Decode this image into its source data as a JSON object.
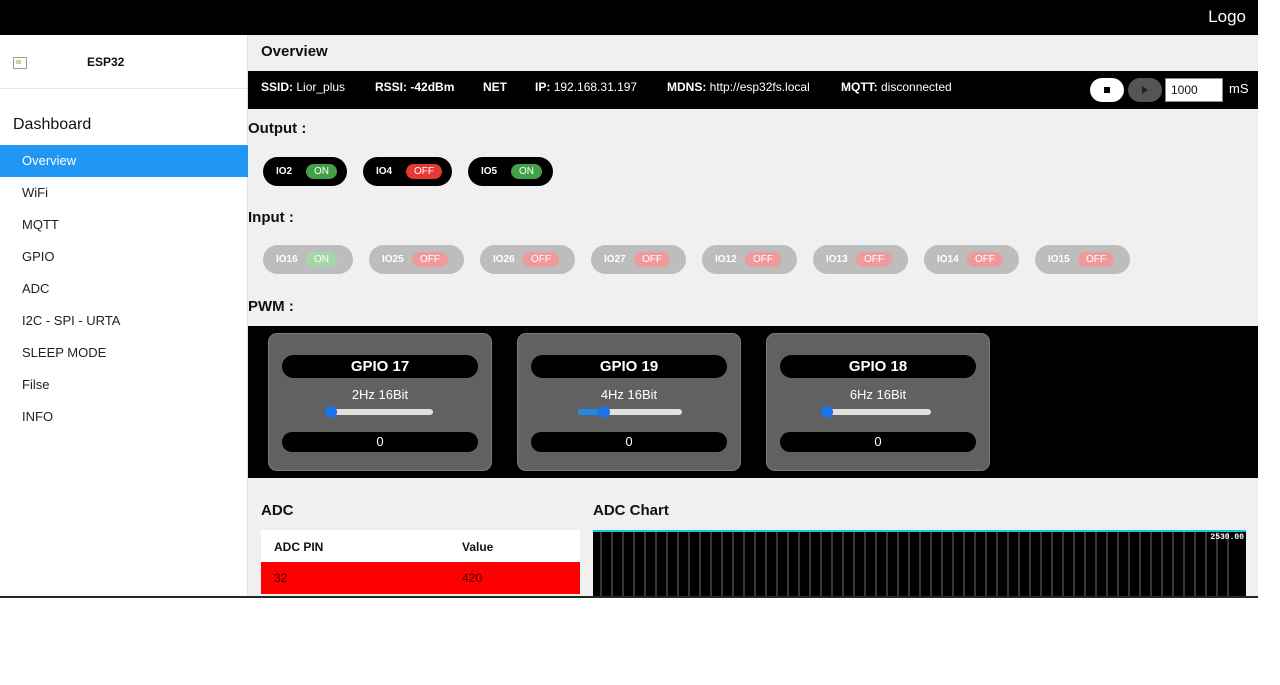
{
  "topbar": {
    "logo": "Logo"
  },
  "sidebar": {
    "brand": "ESP32",
    "section": "Dashboard",
    "items": [
      {
        "label": "Overview",
        "active": true
      },
      {
        "label": "WiFi"
      },
      {
        "label": "MQTT"
      },
      {
        "label": "GPIO"
      },
      {
        "label": "ADC"
      },
      {
        "label": "I2C - SPI - URTA"
      },
      {
        "label": "SLEEP MODE"
      },
      {
        "label": "Filse"
      },
      {
        "label": "INFO"
      }
    ]
  },
  "main": {
    "title": "Overview",
    "status": {
      "ssid_key": "SSID:",
      "ssid": "Lior_plus",
      "rssi_key": "RSSI:",
      "rssi": "-42dBm",
      "net_key": "NET",
      "ip_key": "IP:",
      "ip": "192.168.31.197",
      "mdns_key": "MDNS:",
      "mdns": "http://esp32fs.local",
      "mqtt_key": "MQTT:",
      "mqtt": "disconnected",
      "interval": "1000",
      "interval_unit": "mS"
    },
    "output": {
      "label": "Output :",
      "items": [
        {
          "name": "IO2",
          "state": "ON"
        },
        {
          "name": "IO4",
          "state": "OFF"
        },
        {
          "name": "IO5",
          "state": "ON"
        }
      ]
    },
    "input": {
      "label": "Input :",
      "items": [
        {
          "name": "IO16",
          "state": "ON"
        },
        {
          "name": "IO25",
          "state": "OFF"
        },
        {
          "name": "IO26",
          "state": "OFF"
        },
        {
          "name": "IO27",
          "state": "OFF"
        },
        {
          "name": "IO12",
          "state": "OFF"
        },
        {
          "name": "IO13",
          "state": "OFF"
        },
        {
          "name": "IO14",
          "state": "OFF"
        },
        {
          "name": "IO15",
          "state": "OFF"
        }
      ]
    },
    "pwm": {
      "label": "PWM :",
      "cards": [
        {
          "gpio": "GPIO 17",
          "freq": "2Hz 16Bit",
          "slider_level": 0.02,
          "value": "0"
        },
        {
          "gpio": "GPIO 19",
          "freq": "4Hz 16Bit",
          "slider_level": 0.25,
          "value": "0"
        },
        {
          "gpio": "GPIO 18",
          "freq": "6Hz 16Bit",
          "slider_level": 0.0,
          "value": "0"
        }
      ]
    },
    "adc": {
      "title": "ADC",
      "header_pin": "ADC PIN",
      "header_value": "Value",
      "rows": [
        {
          "pin": "32",
          "value": "420"
        }
      ]
    },
    "adc_chart": {
      "title": "ADC Chart",
      "max_label": "2530.00"
    }
  },
  "colors": {
    "accent": "#2196f3",
    "on": "#43a047",
    "off": "#e53935",
    "adc_row": "#ff0000",
    "chart_line": "#18c7d8"
  }
}
